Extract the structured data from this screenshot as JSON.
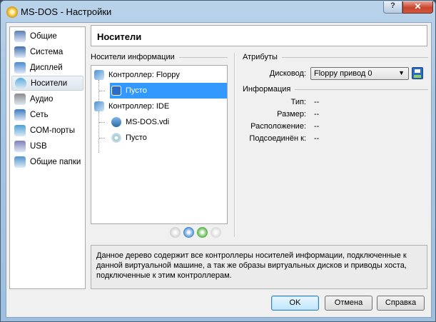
{
  "window": {
    "title": "MS-DOS - Настройки",
    "help_label": "?",
    "close_label": "✕"
  },
  "sidebar": {
    "items": [
      {
        "label": "Общие",
        "icon": "general-icon",
        "color": "#5a7fb5"
      },
      {
        "label": "Система",
        "icon": "system-icon",
        "color": "#3f6fb0"
      },
      {
        "label": "Дисплей",
        "icon": "display-icon",
        "color": "#4a8ad0"
      },
      {
        "label": "Носители",
        "icon": "storage-icon",
        "color": "#5aaee0",
        "selected": true
      },
      {
        "label": "Аудио",
        "icon": "audio-icon",
        "color": "#8a8a8a"
      },
      {
        "label": "Сеть",
        "icon": "network-icon",
        "color": "#3d7cc0"
      },
      {
        "label": "COM-порты",
        "icon": "serial-ports-icon",
        "color": "#4aa0d8"
      },
      {
        "label": "USB",
        "icon": "usb-icon",
        "color": "#7f7fb8"
      },
      {
        "label": "Общие папки",
        "icon": "shared-folders-icon",
        "color": "#4f95d0"
      }
    ]
  },
  "header": {
    "title": "Носители"
  },
  "storage": {
    "group_label": "Носители информации",
    "tree": [
      {
        "label": "Контроллер: Floppy",
        "icon": "controller-icon",
        "level": 0
      },
      {
        "label": "Пусто",
        "icon": "floppy-icon",
        "level": 1,
        "selected": true
      },
      {
        "label": "Контроллер: IDE",
        "icon": "controller-icon",
        "level": 0
      },
      {
        "label": "MS-DOS.vdi",
        "icon": "hard-disk-icon",
        "level": 1
      },
      {
        "label": "Пусто",
        "icon": "cd-icon",
        "level": 1
      }
    ],
    "toolbar": [
      "add-controller-icon",
      "remove-controller-icon",
      "add-attachment-icon",
      "remove-attachment-icon"
    ]
  },
  "attributes": {
    "group_label": "Атрибуты",
    "drive_label": "Дисковод:",
    "drive_value": "Floppy привод 0",
    "info_label": "Информация",
    "rows": [
      {
        "label": "Тип:",
        "value": "--"
      },
      {
        "label": "Размер:",
        "value": "--"
      },
      {
        "label": "Расположение:",
        "value": "--"
      },
      {
        "label": "Подсоединён к:",
        "value": "--"
      }
    ]
  },
  "description": "Данное дерево содержит все контроллеры носителей информации, подключенные к данной виртуальной машине, а так же образы виртуальных дисков и приводы хоста, подключенные к этим контроллерам.",
  "buttons": {
    "ok": "OK",
    "cancel": "Отмена",
    "help": "Справка"
  }
}
